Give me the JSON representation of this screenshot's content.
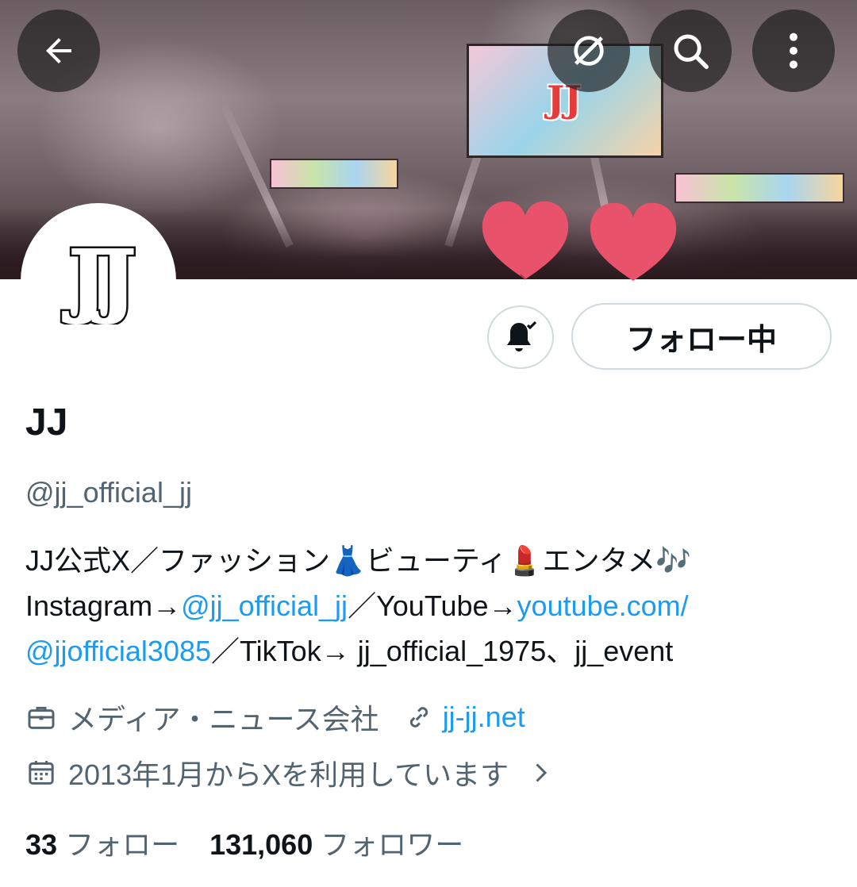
{
  "header": {
    "back_icon": "arrow-left-icon",
    "grok_icon": "slashed-circle-icon",
    "search_icon": "search-icon",
    "more_icon": "more-vertical-icon",
    "banner_screen_logo": "JJ"
  },
  "profile": {
    "avatar_text": "JJ",
    "follow_button_label": "フォロー中",
    "name": "JJ",
    "handle": "@jj_official_jj",
    "bio": {
      "line1": "JJ公式X／ファッション👗ビューティ💄エンタメ🎶",
      "line2_prefix": "Instagram→",
      "line2_link1": "@jj_official_jj",
      "line2_mid": "／YouTube→",
      "line2_link2": "youtube.com/",
      "line3_link": "@jjofficial3085",
      "line3_rest": "／TikTok→ jj_official_1975、jj_event"
    },
    "category": "メディア・ニュース会社",
    "website": "jj-jj.net",
    "joined": "2013年1月からXを利用しています",
    "following_count": "33",
    "following_label": "フォロー",
    "followers_count": "131,060",
    "followers_label": "フォロワー"
  },
  "colors": {
    "link": "#1d9bf0",
    "secondary_text": "#536471",
    "border": "#cfd9de",
    "heart": "#e8526a"
  }
}
